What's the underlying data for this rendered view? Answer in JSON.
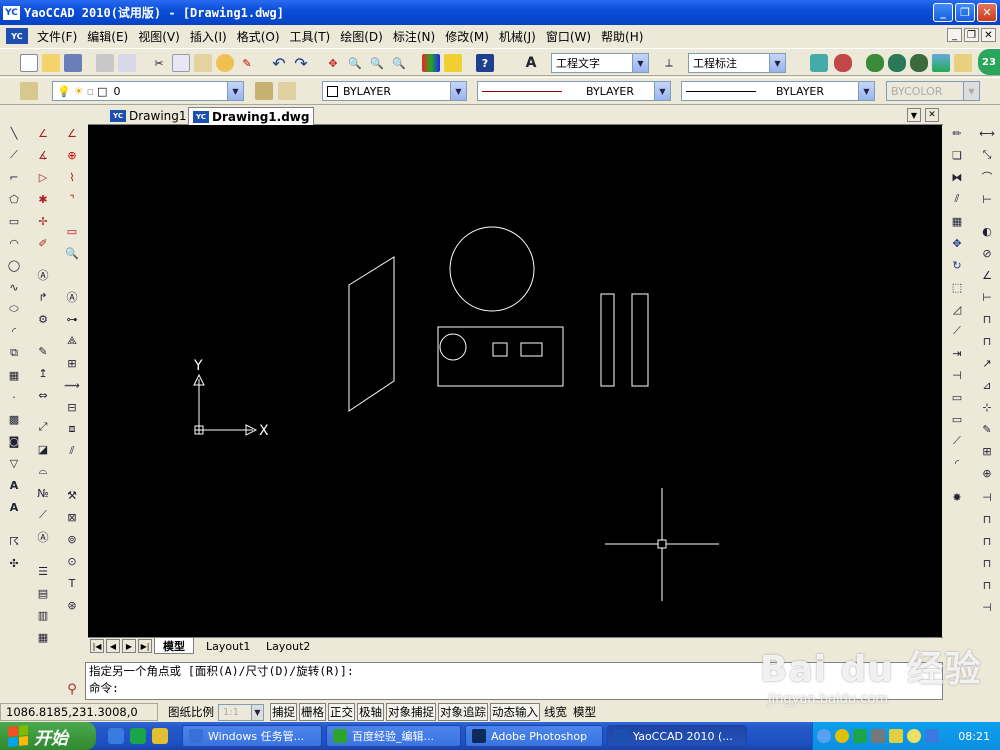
{
  "window": {
    "logo": "YC",
    "title": "YaoCCAD 2010(试用版) - [Drawing1.dwg]",
    "minimize": "_",
    "restore": "❐",
    "close": "✕"
  },
  "menu": {
    "items": [
      "文件(F)",
      "编辑(E)",
      "视图(V)",
      "插入(I)",
      "格式(O)",
      "工具(T)",
      "绘图(D)",
      "标注(N)",
      "修改(M)",
      "机械(J)",
      "窗口(W)",
      "帮助(H)"
    ],
    "mdi_minimize": "_",
    "mdi_restore": "❐",
    "mdi_close": "✕"
  },
  "toolbar": {
    "text_style": "工程文字",
    "dim_style": "工程标注",
    "layer": "0",
    "color": "BYLAYER",
    "linetype": "BYLAYER",
    "lineweight": "BYLAYER",
    "plotstyle": "BYCOLOR",
    "badge": "23"
  },
  "doc_tabs": {
    "tabs": [
      "Drawing1",
      "Drawing1.dwg"
    ],
    "active": 1
  },
  "drawing": {
    "ucs_x": "X",
    "ucs_y": "Y"
  },
  "layout_tabs": [
    "模型",
    "Layout1",
    "Layout2"
  ],
  "command": {
    "line1": "指定另一个角点或 [面积(A)/尺寸(D)/旋转(R)]:",
    "line2": "命令:"
  },
  "status": {
    "coords": "1086.8185,231.3008,0",
    "scale_label": "图纸比例",
    "scale_value": "1:1",
    "toggles": [
      {
        "label": "捕捉",
        "on": true
      },
      {
        "label": "栅格",
        "on": true
      },
      {
        "label": "正交",
        "on": true
      },
      {
        "label": "极轴",
        "on": true
      },
      {
        "label": "对象捕捉",
        "on": true
      },
      {
        "label": "对象追踪",
        "on": true
      },
      {
        "label": "动态输入",
        "on": true
      },
      {
        "label": "线宽",
        "on": false
      },
      {
        "label": "模型",
        "on": false
      }
    ]
  },
  "taskbar": {
    "start": "开始",
    "tasks": [
      {
        "label": "Windows 任务管...",
        "color": "#3a6fd8"
      },
      {
        "label": "百度经验_编辑...",
        "color": "#2da52d"
      },
      {
        "label": "Adobe Photoshop",
        "color": "#0c2b5a"
      },
      {
        "label": "YaoCCAD 2010 (...",
        "color": "#1c4fb0"
      }
    ],
    "clock": "08:21"
  },
  "watermark": {
    "line1": "Bai du 经验",
    "line2": "jingyan.baidu.com"
  }
}
